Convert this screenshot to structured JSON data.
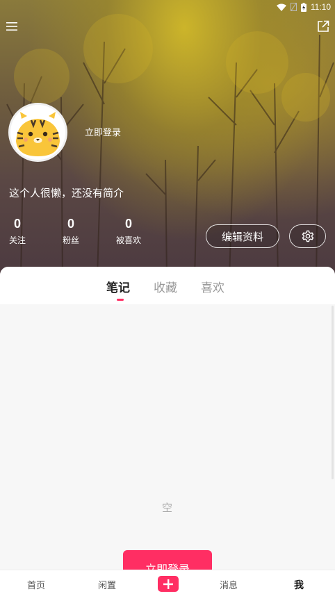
{
  "status_bar": {
    "time": "11:10"
  },
  "profile": {
    "login_text": "立即登录",
    "bio": "这个人很懒，还没有简介",
    "stats": [
      {
        "value": "0",
        "label": "关注"
      },
      {
        "value": "0",
        "label": "粉丝"
      },
      {
        "value": "0",
        "label": "被喜欢"
      }
    ],
    "edit_label": "编辑资料"
  },
  "tabs": [
    {
      "label": "笔记",
      "active": true
    },
    {
      "label": "收藏",
      "active": false
    },
    {
      "label": "喜欢",
      "active": false
    }
  ],
  "content": {
    "empty_text": "空",
    "login_button": "立即登录"
  },
  "bottom_nav": [
    {
      "label": "首页"
    },
    {
      "label": "闲置"
    },
    {
      "label": "消息"
    },
    {
      "label": "我"
    }
  ],
  "icons": {
    "menu": "menu-icon",
    "share": "share-icon",
    "settings": "gear-icon",
    "add": "plus-icon",
    "wifi": "wifi-icon",
    "battery": "battery-icon"
  },
  "colors": {
    "accent": "#ff2e63"
  }
}
